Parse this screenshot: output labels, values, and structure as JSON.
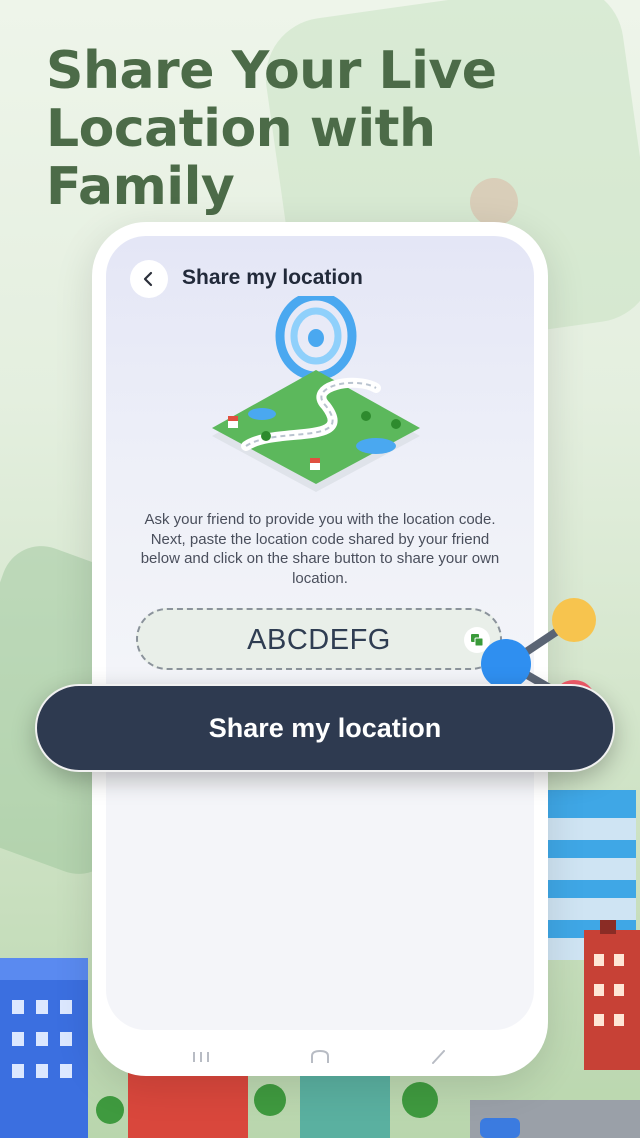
{
  "headline": "Share Your Live Location with Family",
  "screen": {
    "title": "Share my location",
    "description": "Ask your friend to provide you with the location code. Next, paste the location code shared by your friend below and click on the share button to share your own location.",
    "code_value": "ABCDEFG"
  },
  "share_button_label": "Share my location",
  "colors": {
    "headline": "#4c6b48",
    "button": "#2e3a50",
    "map_green": "#5cb85c",
    "dot_yellow": "#f7c44e",
    "dot_blue": "#2f8ff0",
    "dot_red": "#f25c6a"
  }
}
